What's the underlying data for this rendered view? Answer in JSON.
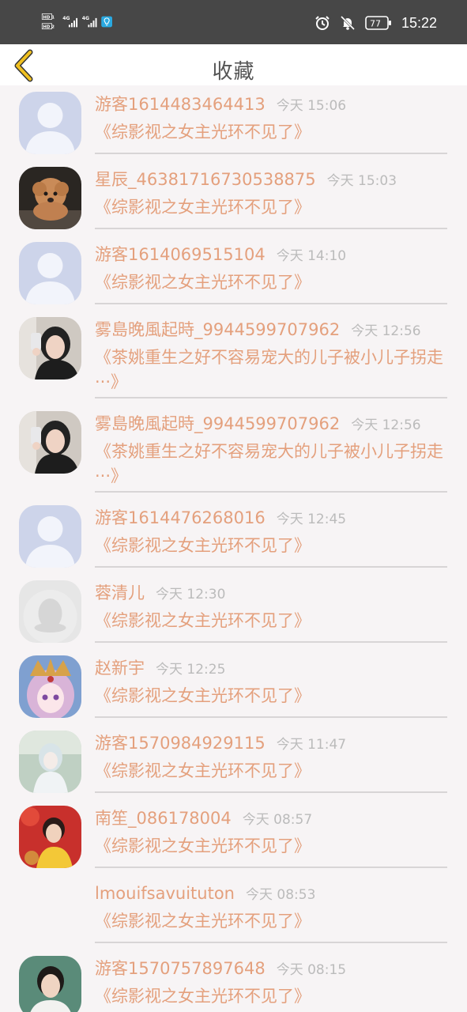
{
  "status_bar": {
    "network_left": [
      "HD 1",
      "HD 2"
    ],
    "signal_labels": [
      "4G",
      "4G"
    ],
    "battery": "77",
    "time": "15:22"
  },
  "header": {
    "title": "收藏",
    "back_icon": "chevron-left-icon",
    "accent_color": "#f0c020"
  },
  "colors": {
    "name": "#e4a07d",
    "time": "#bbbbbb",
    "divider": "#d8d5d6",
    "background": "#f7f4f5"
  },
  "favorites": [
    {
      "user": "游客1614483464413",
      "time": "今天 15:06",
      "book": "《综影视之女主光环不见了》",
      "avatar": "default-avatar"
    },
    {
      "user": "星辰_46381716730538875",
      "time": "今天 15:03",
      "book": "《综影视之女主光环不见了》",
      "avatar": "puppy-photo"
    },
    {
      "user": "游客1614069515104",
      "time": "今天 14:10",
      "book": "《综影视之女主光环不见了》",
      "avatar": "default-avatar"
    },
    {
      "user": "雾島晚風起時_9944599707962",
      "time": "今天 12:56",
      "book": "《茶姚重生之好不容易宠大的儿子被小儿子拐走···》",
      "avatar": "selfie-photo"
    },
    {
      "user": "雾島晚風起時_9944599707962",
      "time": "今天 12:56",
      "book": "《茶姚重生之好不容易宠大的儿子被小儿子拐走···》",
      "avatar": "selfie-photo"
    },
    {
      "user": "游客1614476268016",
      "time": "今天 12:45",
      "book": "《综影视之女主光环不见了》",
      "avatar": "default-avatar"
    },
    {
      "user": "蓉清儿",
      "time": "今天 12:30",
      "book": "《综影视之女主光环不见了》",
      "avatar": "penguin-avatar"
    },
    {
      "user": "赵新宇",
      "time": "今天 12:25",
      "book": "《综影视之女主光环不见了》",
      "avatar": "anime-girl"
    },
    {
      "user": "游客1570984929115",
      "time": "今天 11:47",
      "book": "《综影视之女主光环不见了》",
      "avatar": "doll-photo"
    },
    {
      "user": "南笙_086178004",
      "time": "今天 08:57",
      "book": "《综影视之女主光环不见了》",
      "avatar": "boy-red-photo"
    },
    {
      "user": "lmouifsavuituton",
      "time": "今天 08:53",
      "book": "《综影视之女主光环不见了》",
      "avatar": "none"
    },
    {
      "user": "游客1570757897648",
      "time": "今天 08:15",
      "book": "《综影视之女主光环不见了》",
      "avatar": "boy-photo"
    }
  ]
}
